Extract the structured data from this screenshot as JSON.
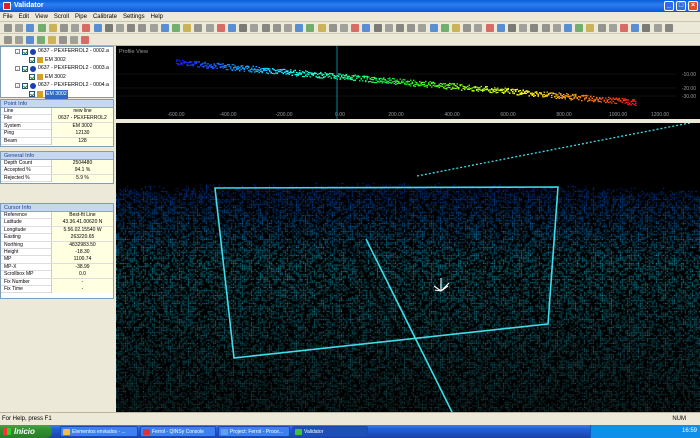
{
  "window": {
    "title": "Validator"
  },
  "menu": [
    "File",
    "Edit",
    "View",
    "Scroll",
    "Pipe",
    "Calibrate",
    "Settings",
    "Help"
  ],
  "tree": {
    "items": [
      {
        "label": "0637 - PEXFERROL2 - 0002.a"
      },
      {
        "label": "EM 3002"
      },
      {
        "label": "0637 - PEXFERROL2 - 0003.a"
      },
      {
        "label": "EM 3002"
      },
      {
        "label": "0637 - PEXFERROL2 - 0004.a"
      },
      {
        "label": "EM 3002"
      }
    ]
  },
  "point_info": {
    "title": "Point Info",
    "rows": [
      {
        "k": "Line",
        "v": "new line"
      },
      {
        "k": "File",
        "v": "0637 - PEXFERROL2"
      },
      {
        "k": "System",
        "v": "EM 3002"
      },
      {
        "k": "Ping",
        "v": "12130"
      },
      {
        "k": "Beam",
        "v": "128"
      }
    ]
  },
  "general_info": {
    "title": "General Info",
    "rows": [
      {
        "k": "Depth Count",
        "v": "2504480"
      },
      {
        "k": "Accepted %",
        "v": "94.1 %"
      },
      {
        "k": "Rejected %",
        "v": "5.9 %"
      }
    ]
  },
  "cursor_info": {
    "title": "Cursor Info",
    "rows": [
      {
        "k": "Reference",
        "v": "Best-fit Line"
      },
      {
        "k": "Latitude",
        "v": "43.36.41.00620 N"
      },
      {
        "k": "Longitude",
        "v": "5.56.02.15540 W"
      },
      {
        "k": "Easting",
        "v": "263220.65"
      },
      {
        "k": "Northing",
        "v": "4832983.50"
      },
      {
        "k": "Height",
        "v": "-18.30"
      },
      {
        "k": "MP",
        "v": "1100.74"
      },
      {
        "k": "MP-X",
        "v": "-38.99"
      },
      {
        "k": "Scrollbox MP",
        "v": "0.0"
      },
      {
        "k": "Fix Number",
        "v": "-"
      },
      {
        "k": "Fix Time",
        "v": "-"
      }
    ]
  },
  "profile": {
    "title": "Profile View",
    "x_ticks": [
      "-600.00",
      "-400.00",
      "-200.00",
      "0.00",
      "200.00",
      "400.00",
      "600.00",
      "800.00",
      "1000.00",
      "1200.00"
    ],
    "y_ticks": [
      "-10.00",
      "-20.00",
      "-30.00"
    ]
  },
  "status": {
    "left": "For Help, press F1",
    "right": "NUM"
  },
  "taskbar": {
    "start": "Inicio",
    "tasks": [
      "Elementos enviados - ...",
      "Ferrol - QINSy Console",
      "Project: Ferrol - Proce...",
      "Validator"
    ],
    "clock": "16:59"
  },
  "colors": {
    "accent": "#245edb",
    "frame": "#3fd8e8",
    "panel_head": "#c6d7f0"
  }
}
